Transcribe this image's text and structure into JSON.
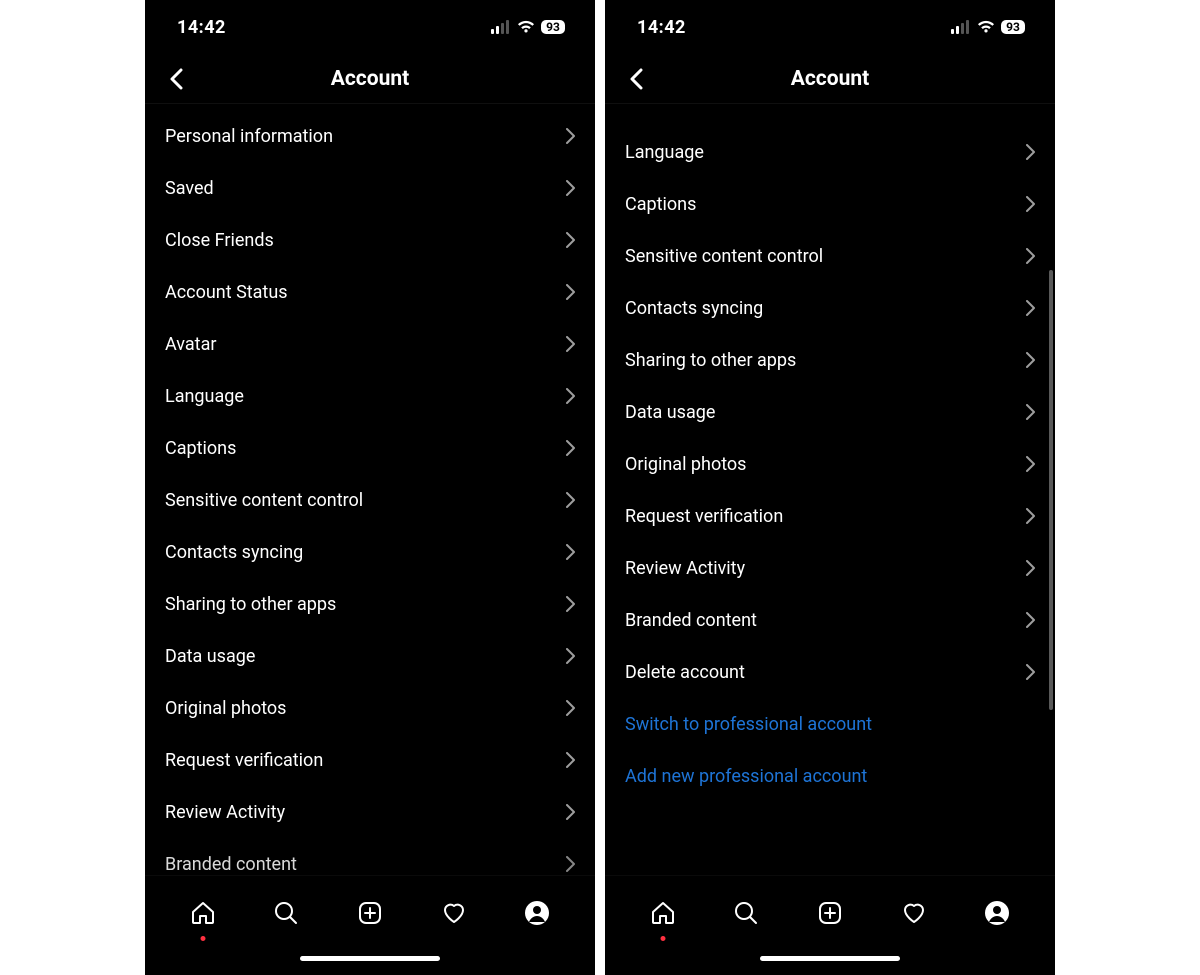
{
  "status": {
    "time": "14:42",
    "battery": "93"
  },
  "header": {
    "title": "Account"
  },
  "left": {
    "items": [
      "Personal information",
      "Saved",
      "Close Friends",
      "Account Status",
      "Avatar",
      "Language",
      "Captions",
      "Sensitive content control",
      "Contacts syncing",
      "Sharing to other apps",
      "Data usage",
      "Original photos",
      "Request verification",
      "Review Activity",
      "Branded content"
    ]
  },
  "right": {
    "items": [
      "Language",
      "Captions",
      "Sensitive content control",
      "Contacts syncing",
      "Sharing to other apps",
      "Data usage",
      "Original photos",
      "Request verification",
      "Review Activity",
      "Branded content",
      "Delete account"
    ],
    "links": [
      "Switch to professional account",
      "Add new professional account"
    ]
  }
}
